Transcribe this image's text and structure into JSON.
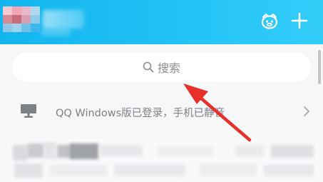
{
  "header": {
    "avatar_icon": "avatar-blurred",
    "mascot_icon": "penguin-face-icon",
    "add_icon": "plus-icon"
  },
  "search": {
    "placeholder": "搜索",
    "icon": "search-icon"
  },
  "device_notice": {
    "icon": "computer-icon",
    "text": "QQ Windows版已登录，手机已静音",
    "chevron_icon": "chevron-right-icon"
  },
  "annotation": {
    "arrow_color": "#e8302a"
  },
  "colors": {
    "header_start": "#12b5ee",
    "header_end": "#33cdf9",
    "content_bg": "#f6f7f9",
    "muted_text": "#7d8186"
  }
}
